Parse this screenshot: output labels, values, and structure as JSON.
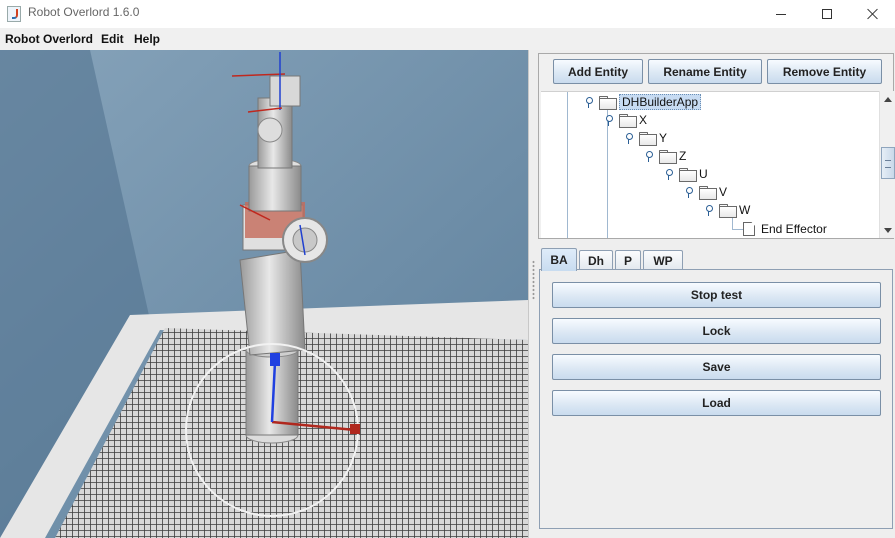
{
  "window": {
    "title": "Robot Overlord 1.6.0"
  },
  "menu": {
    "items": [
      "Robot Overlord",
      "Edit",
      "Help"
    ]
  },
  "toolbar": {
    "add": "Add Entity",
    "rename": "Rename Entity",
    "remove": "Remove Entity"
  },
  "tree": {
    "nodes": [
      {
        "label": "DHBuilderApp",
        "selected": true
      },
      {
        "label": "X"
      },
      {
        "label": "Y"
      },
      {
        "label": "Z"
      },
      {
        "label": "U"
      },
      {
        "label": "V"
      },
      {
        "label": "W"
      },
      {
        "label": "End Effector",
        "leaf": true
      }
    ]
  },
  "tabs": [
    {
      "label": "BA",
      "active": true
    },
    {
      "label": "Dh"
    },
    {
      "label": "P"
    },
    {
      "label": "WP"
    }
  ],
  "actions": [
    "Stop test",
    "Lock",
    "Save",
    "Load"
  ],
  "icons": {
    "window": "java-cup-icon",
    "minimize": "minimize-icon",
    "maximize": "maximize-icon",
    "close": "close-icon",
    "tree_handle": "key-handle-icon",
    "folder": "folder-icon",
    "leaf": "document-icon"
  },
  "colors": {
    "sky": "#6e8ea8",
    "floor_grid": "#404040",
    "selection": "#c7dbf2",
    "x_axis": "#c0281e",
    "z_axis": "#2040d0"
  }
}
